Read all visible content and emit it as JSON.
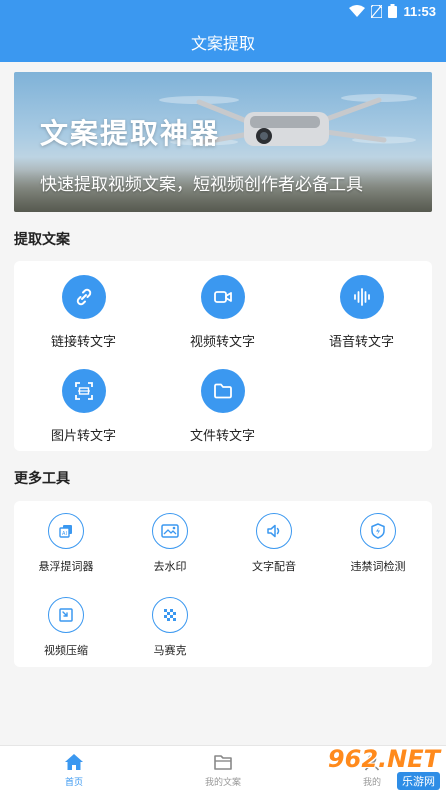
{
  "status_bar": {
    "time": "11:53"
  },
  "app_bar": {
    "title": "文案提取"
  },
  "banner": {
    "headline": "文案提取神器",
    "subline": "快速提取视频文案，短视频创作者必备工具"
  },
  "extract_section": {
    "title": "提取文案",
    "items": [
      {
        "label": "链接转文字",
        "icon": "link-icon"
      },
      {
        "label": "视频转文字",
        "icon": "video-camera-icon"
      },
      {
        "label": "语音转文字",
        "icon": "waveform-icon"
      },
      {
        "label": "图片转文字",
        "icon": "image-scan-icon"
      },
      {
        "label": "文件转文字",
        "icon": "folder-icon"
      }
    ]
  },
  "tools_section": {
    "title": "更多工具",
    "items": [
      {
        "label": "悬浮提词器",
        "icon": "teleprompter-icon"
      },
      {
        "label": "去水印",
        "icon": "watermark-remove-icon"
      },
      {
        "label": "文字配音",
        "icon": "speaker-icon"
      },
      {
        "label": "违禁词检测",
        "icon": "shield-bolt-icon"
      },
      {
        "label": "视频压缩",
        "icon": "compress-icon"
      },
      {
        "label": "马赛克",
        "icon": "mosaic-icon"
      }
    ]
  },
  "bottom_nav": {
    "items": [
      {
        "label": "首页",
        "icon": "home-icon",
        "active": true
      },
      {
        "label": "我的文案",
        "icon": "folder-doc-icon",
        "active": false
      },
      {
        "label": "我的",
        "icon": "user-icon",
        "active": false
      }
    ]
  },
  "watermark": {
    "brand": "962.NET",
    "site": "乐游网"
  },
  "colors": {
    "accent": "#3b98f0",
    "background": "#f5f5f5"
  }
}
